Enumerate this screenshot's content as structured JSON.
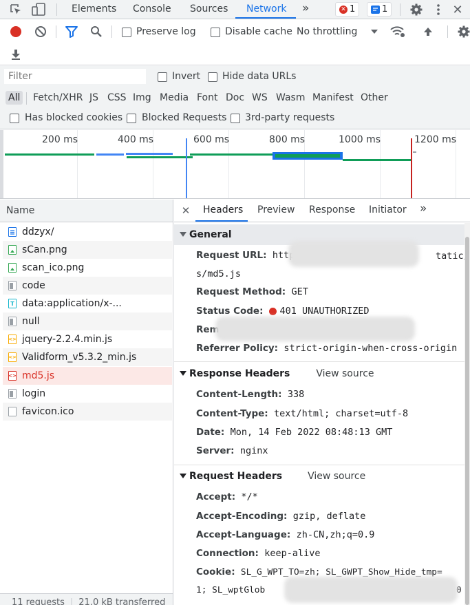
{
  "tabs": {
    "items": [
      "Elements",
      "Console",
      "Sources",
      "Network"
    ],
    "active": "Network",
    "more": "»",
    "error_count": "1",
    "message_count": "1"
  },
  "toolbar": {
    "preserve_log": "Preserve log",
    "disable_cache": "Disable cache",
    "throttling": "No throttling"
  },
  "filter": {
    "placeholder": "Filter",
    "invert": "Invert",
    "hide_data_urls": "Hide data URLs",
    "types": [
      "All",
      "Fetch/XHR",
      "JS",
      "CSS",
      "Img",
      "Media",
      "Font",
      "Doc",
      "WS",
      "Wasm",
      "Manifest",
      "Other"
    ],
    "has_blocked_cookies": "Has blocked cookies",
    "blocked_requests": "Blocked Requests",
    "third_party": "3rd-party requests"
  },
  "overview": {
    "ticks": [
      "200 ms",
      "400 ms",
      "600 ms",
      "800 ms",
      "1000 ms",
      "1200 ms"
    ]
  },
  "list": {
    "header": "Name",
    "items": [
      {
        "name": "ddzyx/",
        "icon": "document-icon"
      },
      {
        "name": "sCan.png",
        "icon": "image-icon"
      },
      {
        "name": "scan_ico.png",
        "icon": "image-icon"
      },
      {
        "name": "code",
        "icon": "file-icon"
      },
      {
        "name": "data:application/x-...",
        "icon": "font-icon"
      },
      {
        "name": "null",
        "icon": "file-icon"
      },
      {
        "name": "jquery-2.2.4.min.js",
        "icon": "script-icon"
      },
      {
        "name": "Validform_v5.3.2_min.js",
        "icon": "script-icon"
      },
      {
        "name": "md5.js",
        "icon": "script-icon"
      },
      {
        "name": "login",
        "icon": "file-icon"
      },
      {
        "name": "favicon.ico",
        "icon": "blank-file-icon"
      }
    ],
    "footer_requests": "11 requests",
    "footer_transferred": "21.0 kB transferred"
  },
  "details": {
    "tabs": [
      "Headers",
      "Preview",
      "Response",
      "Initiator"
    ],
    "more": "»",
    "general": {
      "title": "General",
      "request_url_key": "Request URL:",
      "request_url_start": "http",
      "request_url_end": "tatic/j",
      "request_url_line2": "s/md5.js",
      "method_key": "Request Method:",
      "method_value": "GET",
      "status_key": "Status Code:",
      "status_value": "401 UNAUTHORIZED",
      "remote_key": "Rem",
      "referrer_key": "Referrer Policy:",
      "referrer_value": "strict-origin-when-cross-origin"
    },
    "response_headers": {
      "title": "Response Headers",
      "view_source": "View source",
      "rows": [
        {
          "k": "Content-Length:",
          "v": "338"
        },
        {
          "k": "Content-Type:",
          "v": "text/html; charset=utf-8"
        },
        {
          "k": "Date:",
          "v": "Mon, 14 Feb 2022 08:48:13 GMT"
        },
        {
          "k": "Server:",
          "v": "nginx"
        }
      ]
    },
    "request_headers": {
      "title": "Request Headers",
      "view_source": "View source",
      "rows": [
        {
          "k": "Accept:",
          "v": "*/*"
        },
        {
          "k": "Accept-Encoding:",
          "v": "gzip, deflate"
        },
        {
          "k": "Accept-Language:",
          "v": "zh-CN,zh;q=0.9"
        },
        {
          "k": "Connection:",
          "v": "keep-alive"
        }
      ],
      "cookie_key": "Cookie:",
      "cookie_line1": "SL_G_WPT_TO=zh; SL_GWPT_Show_Hide_tmp=",
      "cookie_line2_start": "1; SL_wptGlob",
      "cookie_line2_end": "0"
    }
  },
  "colors": {
    "accent": "#1a73e8",
    "error": "#d93025",
    "selected_row": "#fce8e6"
  }
}
